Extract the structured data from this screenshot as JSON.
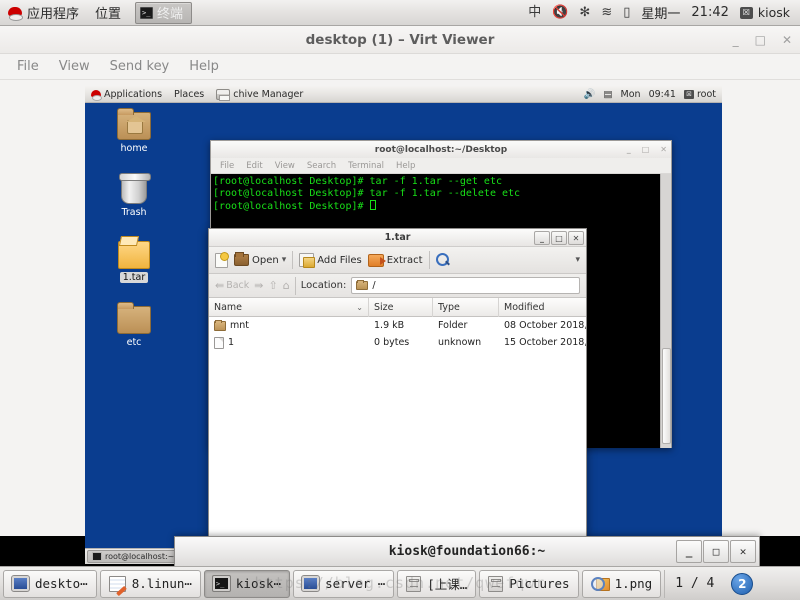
{
  "host_panel": {
    "logo_icon": "redhat-logo-icon",
    "applications_label": "应用程序",
    "places_label": "位置",
    "window_button": {
      "label": "终端",
      "icon": "terminal-icon"
    },
    "tray": {
      "input_method": "中",
      "volume_icon": "volume-muted-icon",
      "bluetooth_icon": "bluetooth-icon",
      "network_icon": "wifi-icon",
      "battery_icon": "battery-charging-icon",
      "day": "星期一",
      "time": "21:42",
      "user_icon": "user-icon",
      "user": "kiosk"
    }
  },
  "virt_viewer": {
    "title": "desktop (1) – Virt Viewer",
    "window_controls": {
      "minimize": "_",
      "maximize": "□",
      "close": "✕"
    },
    "menus": [
      "File",
      "View",
      "Send key",
      "Help"
    ]
  },
  "vm": {
    "panel": {
      "logo_icon": "redhat-logo-icon",
      "applications_label": "Applications",
      "places_label": "Places",
      "active_app_icon": "archive-manager-icon",
      "active_app_label": "chive Manager",
      "tray": {
        "volume_icon": "volume-icon",
        "network_icon": "network-icon",
        "day": "Mon",
        "time": "09:41",
        "user_icon": "user-icon",
        "user": "root"
      }
    },
    "desktop_icons": [
      {
        "label": "home",
        "icon": "home-folder-icon",
        "selected": false
      },
      {
        "label": "Trash",
        "icon": "trash-icon",
        "selected": false
      },
      {
        "label": "1.tar",
        "icon": "tar-archive-icon",
        "selected": true
      },
      {
        "label": "etc",
        "icon": "folder-icon",
        "selected": false
      }
    ],
    "terminal": {
      "title": "root@localhost:~/Desktop",
      "window_controls": {
        "minimize": "_",
        "maximize": "□",
        "close": "✕"
      },
      "menus": [
        "File",
        "Edit",
        "View",
        "Search",
        "Terminal",
        "Help"
      ],
      "lines": [
        "[root@localhost Desktop]# tar -f 1.tar --get etc",
        "[root@localhost Desktop]# tar -f 1.tar --delete etc",
        "[root@localhost Desktop]# "
      ]
    },
    "archive_manager": {
      "title": "1.tar",
      "window_controls": {
        "minimize": "_",
        "maximize": "□",
        "close": "✕"
      },
      "toolbar": {
        "new_icon": "new-archive-icon",
        "open_icon": "open-folder-icon",
        "open_label": "Open",
        "open_dropdown": "▾",
        "add_files_icon": "add-files-icon",
        "add_files_label": "Add Files",
        "extract_icon": "extract-icon",
        "extract_label": "Extract",
        "search_icon": "search-icon",
        "overflow_chevron": "▾"
      },
      "navbar": {
        "back_icon": "back-arrow-icon",
        "back_label": "Back",
        "forward_icon": "forward-arrow-icon",
        "up_icon": "up-arrow-icon",
        "home_icon": "home-icon",
        "location_label": "Location:",
        "location_icon": "folder-icon",
        "location_value": "/"
      },
      "columns": [
        "Name",
        "Size",
        "Type",
        "Modified"
      ],
      "sort_indicator": "⌄",
      "rows": [
        {
          "icon": "folder-icon",
          "name": "mnt",
          "size": "1.9 kB",
          "type": "Folder",
          "modified": "08 October 2018, ..."
        },
        {
          "icon": "file-icon",
          "name": "1",
          "size": "0 bytes",
          "type": "unknown",
          "modified": "15 October 2018, ..."
        }
      ]
    },
    "taskbar": [
      {
        "icon": "terminal-icon",
        "label": "root@localhost:~/D"
      }
    ]
  },
  "host_terminal_window": {
    "title": "kiosk@foundation66:~",
    "window_controls": {
      "minimize": "_",
      "maximize": "□",
      "close": "✕"
    }
  },
  "taskbar": {
    "buttons": [
      {
        "icon": "monitor-icon",
        "label": "deskto⋯",
        "active": false
      },
      {
        "icon": "notepad-icon",
        "label": "8.linun⋯",
        "active": false
      },
      {
        "icon": "terminal-icon",
        "label": "kiosk⋯",
        "active": true
      },
      {
        "icon": "monitor-icon",
        "label": "server ⋯",
        "active": false
      },
      {
        "icon": "file-cabinet-icon",
        "label": "[上课…",
        "active": false
      },
      {
        "icon": "file-cabinet-icon",
        "label": "Pictures",
        "active": false
      },
      {
        "icon": "image-viewer-icon",
        "label": "1.png",
        "active": false
      }
    ],
    "pager": "1 / 4",
    "workspace_badge": "2"
  },
  "watermark": "https://blog.csdn.net/qwefqwr",
  "colors": {
    "vm_desktop_blue": "#0a3d8f",
    "terminal_green": "#18e018",
    "panel_gray": "#e4e2e0",
    "accent_blue": "#1f5fae"
  }
}
